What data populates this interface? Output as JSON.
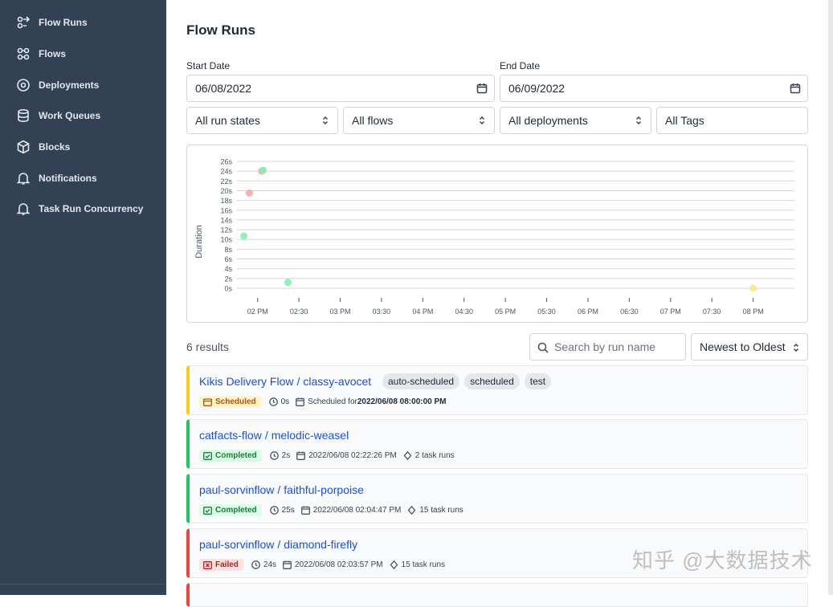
{
  "sidebar": {
    "items": [
      {
        "label": "Flow Runs",
        "icon": "flow-runs-icon"
      },
      {
        "label": "Flows",
        "icon": "flows-icon"
      },
      {
        "label": "Deployments",
        "icon": "map-pin-icon"
      },
      {
        "label": "Work Queues",
        "icon": "database-icon"
      },
      {
        "label": "Blocks",
        "icon": "cube-icon"
      },
      {
        "label": "Notifications",
        "icon": "bell-icon"
      },
      {
        "label": "Task Run Concurrency",
        "icon": "bell-icon"
      }
    ]
  },
  "page": {
    "title": "Flow Runs"
  },
  "filters": {
    "start_date_label": "Start Date",
    "start_date": "06/08/2022",
    "end_date_label": "End Date",
    "end_date": "06/09/2022",
    "run_states": "All run states",
    "flows": "All flows",
    "deployments": "All deployments",
    "tags": "All Tags"
  },
  "chart_data": {
    "type": "scatter",
    "ylabel": "Duration",
    "y_ticks": [
      "0s",
      "2s",
      "4s",
      "6s",
      "8s",
      "10s",
      "12s",
      "14s",
      "16s",
      "18s",
      "20s",
      "22s",
      "24s",
      "26s"
    ],
    "x_ticks": [
      "02 PM",
      "02:30",
      "03 PM",
      "03:30",
      "04 PM",
      "04:30",
      "05 PM",
      "05:30",
      "06 PM",
      "06:30",
      "07 PM",
      "07:30",
      "08 PM"
    ],
    "ylim": [
      0,
      26
    ],
    "grid": true,
    "points": [
      {
        "time": "13:50",
        "duration_s": 10.7,
        "state": "Completed",
        "color": "#86efac"
      },
      {
        "time": "13:54",
        "duration_s": 19.5,
        "state": "Failed",
        "color": "#fca5a5"
      },
      {
        "time": "14:03",
        "duration_s": 24,
        "state": "Failed",
        "color": "#fca5a5"
      },
      {
        "time": "14:04",
        "duration_s": 24.2,
        "state": "Completed",
        "color": "#86efac"
      },
      {
        "time": "14:22",
        "duration_s": 1.2,
        "state": "Completed",
        "color": "#86efac"
      },
      {
        "time": "20:00",
        "duration_s": 0,
        "state": "Scheduled",
        "color": "#fde68a"
      }
    ]
  },
  "results": {
    "count_label": "6 results",
    "search_placeholder": "Search by run name",
    "sort_value": "Newest to Oldest"
  },
  "runs": [
    {
      "flow": "Kikis Delivery Flow",
      "name": "classy-avocet",
      "state": "Scheduled",
      "state_color": "#facc15",
      "duration": "0s",
      "date_prefix": "Scheduled for ",
      "date": "2022/06/08 08:00:00 PM",
      "task_runs": "",
      "tags": [
        "auto-scheduled",
        "scheduled",
        "test"
      ]
    },
    {
      "flow": "catfacts-flow",
      "name": "melodic-weasel",
      "state": "Completed",
      "state_color": "#22c55e",
      "duration": "2s",
      "date_prefix": "",
      "date": "2022/06/08 02:22:26 PM",
      "task_runs": "2 task runs",
      "tags": []
    },
    {
      "flow": "paul-sorvinflow",
      "name": "faithful-porpoise",
      "state": "Completed",
      "state_color": "#22c55e",
      "duration": "25s",
      "date_prefix": "",
      "date": "2022/06/08 02:04:47 PM",
      "task_runs": "15 task runs",
      "tags": []
    },
    {
      "flow": "paul-sorvinflow",
      "name": "diamond-firefly",
      "state": "Failed",
      "state_color": "#ef4444",
      "duration": "24s",
      "date_prefix": "",
      "date": "2022/06/08 02:03:57 PM",
      "task_runs": "15 task runs",
      "tags": []
    }
  ],
  "watermark": "知乎 @大数据技术"
}
